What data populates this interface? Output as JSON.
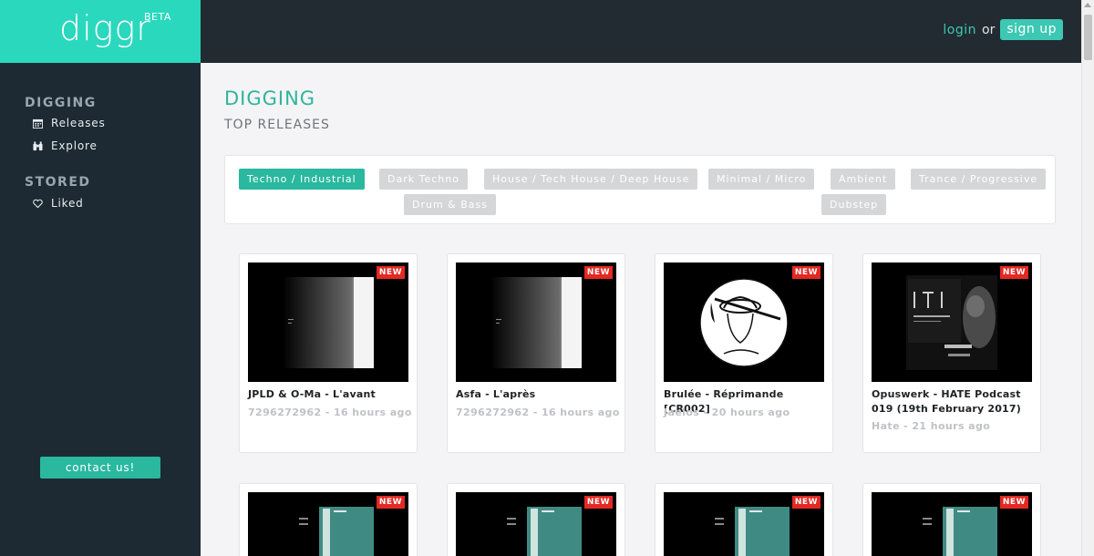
{
  "brand": {
    "logo": "diggr",
    "badge": "BETA"
  },
  "auth": {
    "login_label": "login",
    "or_label": "or",
    "signup_label": "sign up"
  },
  "sidebar": {
    "digging_title": "DIGGING",
    "stored_title": "STORED",
    "items": [
      {
        "label": "Releases",
        "icon": "calendar-icon"
      },
      {
        "label": "Explore",
        "icon": "binoculars-icon"
      },
      {
        "label": "Liked",
        "icon": "heart-icon"
      }
    ],
    "contact_label": "contact us!"
  },
  "main": {
    "title": "DIGGING",
    "subtitle": "TOP RELEASES",
    "genres": [
      "Techno / Industrial",
      "Dark Techno",
      "House / Tech House / Deep House",
      "Minimal / Micro",
      "Ambient",
      "Trance / Progressive",
      "Drum & Bass",
      "Dubstep"
    ],
    "active_genre": "Techno / Industrial",
    "new_badge": "NEW",
    "releases": [
      {
        "title": "JPLD & O-Ma - L'avant",
        "meta": "7296272962 - 16 hours ago"
      },
      {
        "title": "Asfa - L'après",
        "meta": "7296272962 - 16 hours ago"
      },
      {
        "title": "Brulée - Réprimande [CR002]",
        "meta": "Jaelos - 20 hours ago"
      },
      {
        "title": "Opuswerk - HATE Podcast 019 (19th February 2017)",
        "meta": "Hate - 21 hours ago"
      }
    ]
  },
  "colors": {
    "brand": "#2ad8bd",
    "accent": "#2ab89f",
    "topbar": "#232b32",
    "sidebar": "#1d2a33",
    "badge": "#e32922"
  }
}
